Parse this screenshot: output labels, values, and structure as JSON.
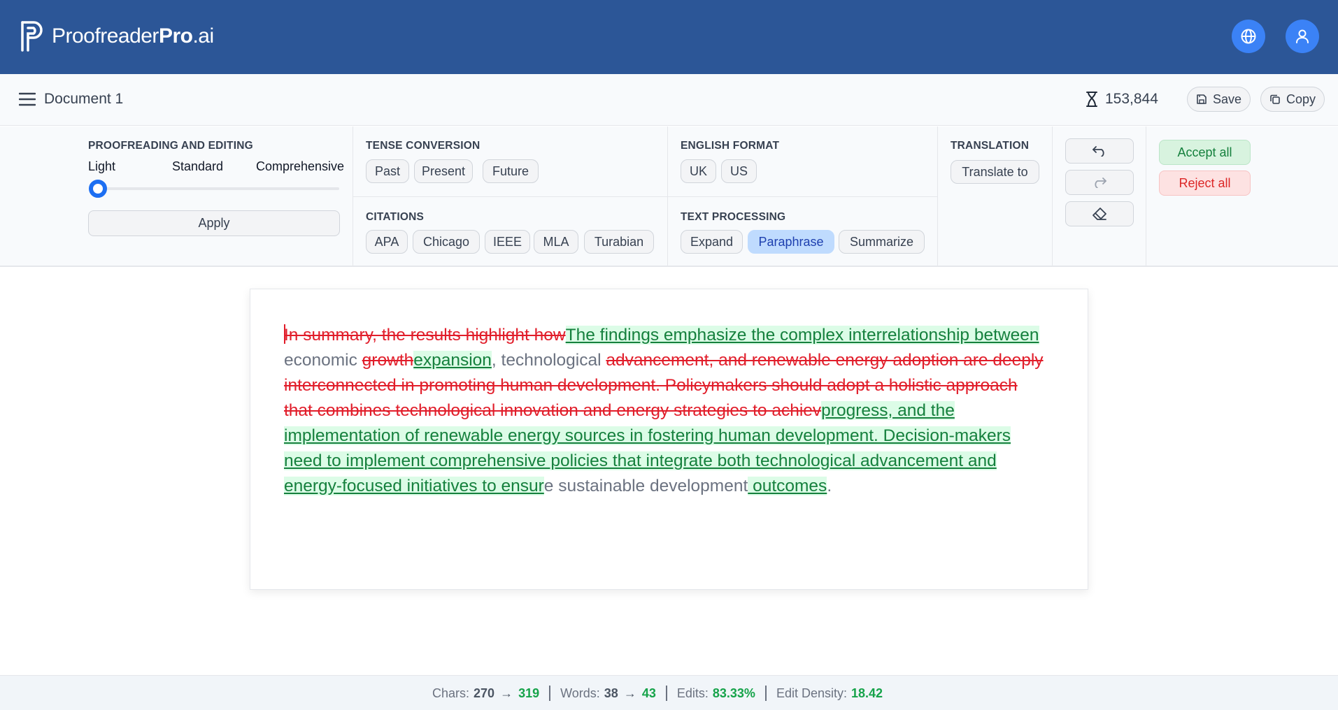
{
  "brand": {
    "name_regular": "Proofreader",
    "name_bold": "Pro",
    "name_suffix": ".ai"
  },
  "header": {
    "language_icon": "globe-icon",
    "account_icon": "user-icon"
  },
  "docbar": {
    "title": "Document 1",
    "token_count": "153,844",
    "save_label": "Save",
    "copy_label": "Copy"
  },
  "toolbar": {
    "proofreading": {
      "title": "PROOFREADING AND EDITING",
      "levels": [
        "Light",
        "Standard",
        "Comprehensive"
      ],
      "selected_level": "Light",
      "apply_label": "Apply"
    },
    "tense": {
      "title": "TENSE CONVERSION",
      "options": [
        "Past",
        "Present",
        "Future"
      ]
    },
    "citations": {
      "title": "CITATIONS",
      "options": [
        "APA",
        "Chicago",
        "IEEE",
        "MLA",
        "Turabian"
      ]
    },
    "english_format": {
      "title": "ENGLISH FORMAT",
      "options": [
        "UK",
        "US"
      ]
    },
    "text_processing": {
      "title": "TEXT PROCESSING",
      "options": [
        "Expand",
        "Paraphrase",
        "Summarize"
      ],
      "active": "Paraphrase"
    },
    "translation": {
      "title": "TRANSLATION",
      "button_label": "Translate to"
    },
    "actions": {
      "accept_all": "Accept all",
      "reject_all": "Reject all"
    }
  },
  "editor": {
    "segments": [
      {
        "type": "del",
        "text": "In summary, the results highlight how"
      },
      {
        "type": "ins",
        "text": "The findings emphasize the complex interrelationship between"
      },
      {
        "type": "plain",
        "text": " economic "
      },
      {
        "type": "del",
        "text": "growth"
      },
      {
        "type": "ins",
        "text": "expansion"
      },
      {
        "type": "plain",
        "text": ", technological "
      },
      {
        "type": "del",
        "text": "advancement, and renewable energy adoption are deeply interconnected in promoting human development. Policymakers should adopt a holistic approach that combines technological innovation and energy strategies to achiev"
      },
      {
        "type": "ins",
        "text": "progress, and the implementation of renewable energy sources in fostering human development. Decision-makers need to implement comprehensive policies that integrate both technological advancement and energy-focused initiatives to ensur"
      },
      {
        "type": "plain",
        "text": "e sustainable development"
      },
      {
        "type": "ins",
        "text": " outcomes"
      },
      {
        "type": "plain",
        "text": "."
      }
    ]
  },
  "footer": {
    "chars_label": "Chars:",
    "chars_before": "270",
    "chars_after": "319",
    "words_label": "Words:",
    "words_before": "38",
    "words_after": "43",
    "edits_label": "Edits:",
    "edits_value": "83.33%",
    "density_label": "Edit Density:",
    "density_value": "18.42"
  },
  "colors": {
    "header_bg": "#2c5697",
    "accent": "#3b82f6",
    "deletion": "#e11d2a",
    "insertion": "#15803d",
    "insertion_bg": "#dcfce7"
  }
}
